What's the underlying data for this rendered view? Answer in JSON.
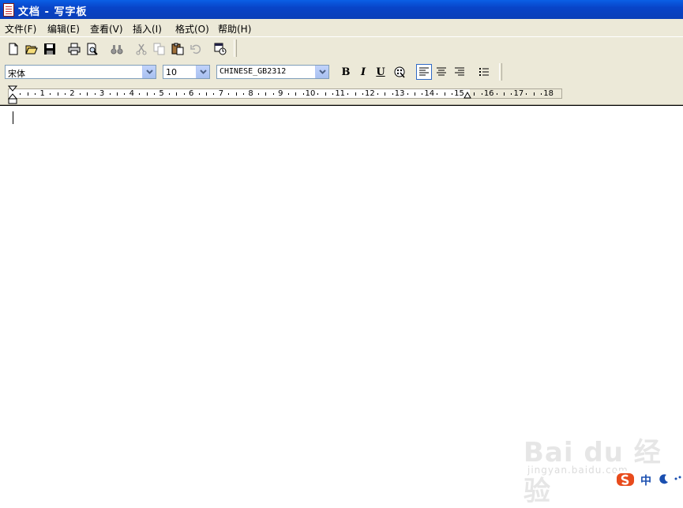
{
  "window": {
    "title": "文档 - 写字板",
    "icon": "wordpad-document-icon"
  },
  "menu": [
    {
      "label": "文件(F)"
    },
    {
      "label": "编辑(E)"
    },
    {
      "label": "查看(V)"
    },
    {
      "label": "插入(I)"
    },
    {
      "label": "格式(O)"
    },
    {
      "label": "帮助(H)"
    }
  ],
  "toolbar": {
    "icons": [
      "new-document-icon",
      "open-folder-icon",
      "save-disk-icon",
      "print-icon",
      "print-preview-icon",
      "find-binoculars-icon",
      "cut-scissors-icon",
      "copy-icon",
      "paste-icon",
      "undo-icon",
      "insert-date-time-icon"
    ]
  },
  "format_bar": {
    "font_name": "宋体",
    "font_size": "10",
    "script": "CHINESE_GB2312",
    "bold": "B",
    "italic": "I",
    "underline": "U",
    "icons": [
      "bold-icon",
      "italic-icon",
      "underline-icon",
      "font-color-icon",
      "align-left-icon",
      "align-center-icon",
      "align-right-icon",
      "bullets-icon"
    ],
    "align_selected": "left"
  },
  "ruler": {
    "numbers": [
      "1",
      "2",
      "3",
      "4",
      "5",
      "6",
      "7",
      "8",
      "9",
      "10",
      "11",
      "12",
      "13",
      "14",
      "15",
      "16",
      "17",
      "18"
    ]
  },
  "document": {
    "text": ""
  },
  "watermark": {
    "brand": "Bai du 经验",
    "url": "jingyan.baidu.com"
  },
  "ime": {
    "mode": "中"
  }
}
